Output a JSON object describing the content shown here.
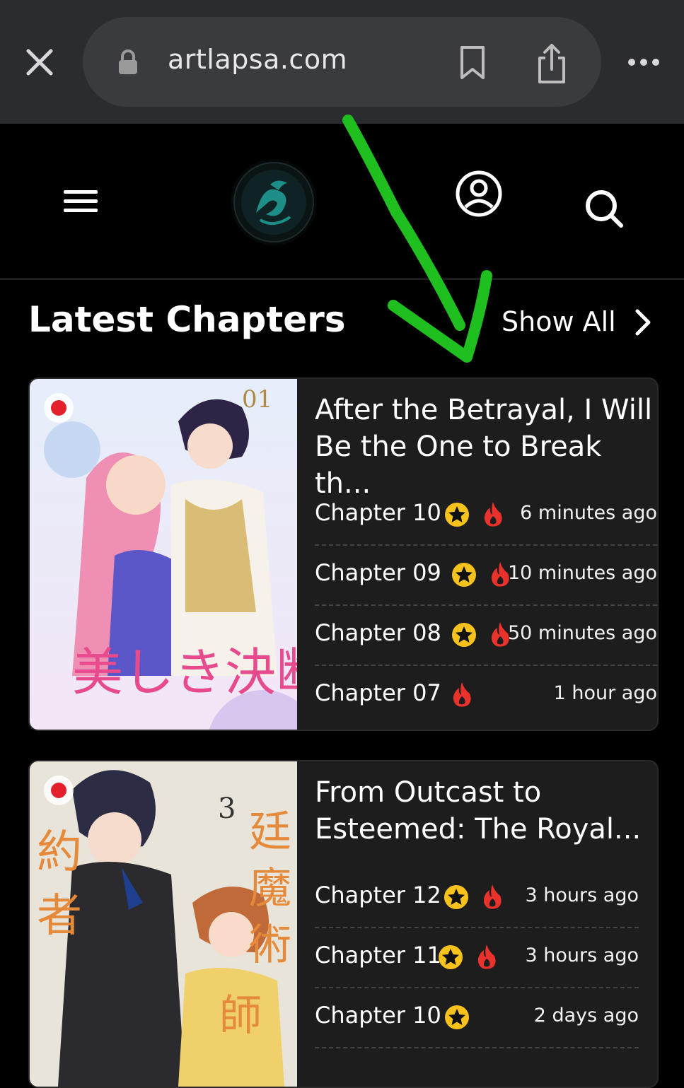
{
  "browser": {
    "url": "artlapsa.com",
    "icons": [
      "close-icon",
      "lock-icon",
      "bookmark-icon",
      "share-icon",
      "more-icon"
    ]
  },
  "header": {
    "icons": [
      "hamburger-menu-icon",
      "site-logo",
      "account-icon",
      "search-icon"
    ]
  },
  "section": {
    "title": "Latest Chapters",
    "show_all": "Show All"
  },
  "colors": {
    "accent_star": "#f7c21b",
    "fire": "#e8322b",
    "annotation": "#1fbf1f"
  },
  "series": [
    {
      "title": "After the Betrayal, I Will Be the One to Break th...",
      "chapters": [
        {
          "label": "Chapter 10",
          "time": "6 minutes ago",
          "star": true,
          "fire": true
        },
        {
          "label": "Chapter 09",
          "time": "10 minutes ago",
          "star": true,
          "fire": true
        },
        {
          "label": "Chapter 08",
          "time": "50 minutes ago",
          "star": true,
          "fire": true
        },
        {
          "label": "Chapter 07",
          "time": "1 hour ago",
          "star": false,
          "fire": true
        }
      ]
    },
    {
      "title": "From Outcast to Esteemed: The Royal...",
      "chapters": [
        {
          "label": "Chapter 12",
          "time": "3 hours ago",
          "star": true,
          "fire": true
        },
        {
          "label": "Chapter 11",
          "time": "3 hours ago",
          "star": true,
          "fire": true
        },
        {
          "label": "Chapter 10",
          "time": "2 days ago",
          "star": true,
          "fire": false
        }
      ]
    }
  ]
}
